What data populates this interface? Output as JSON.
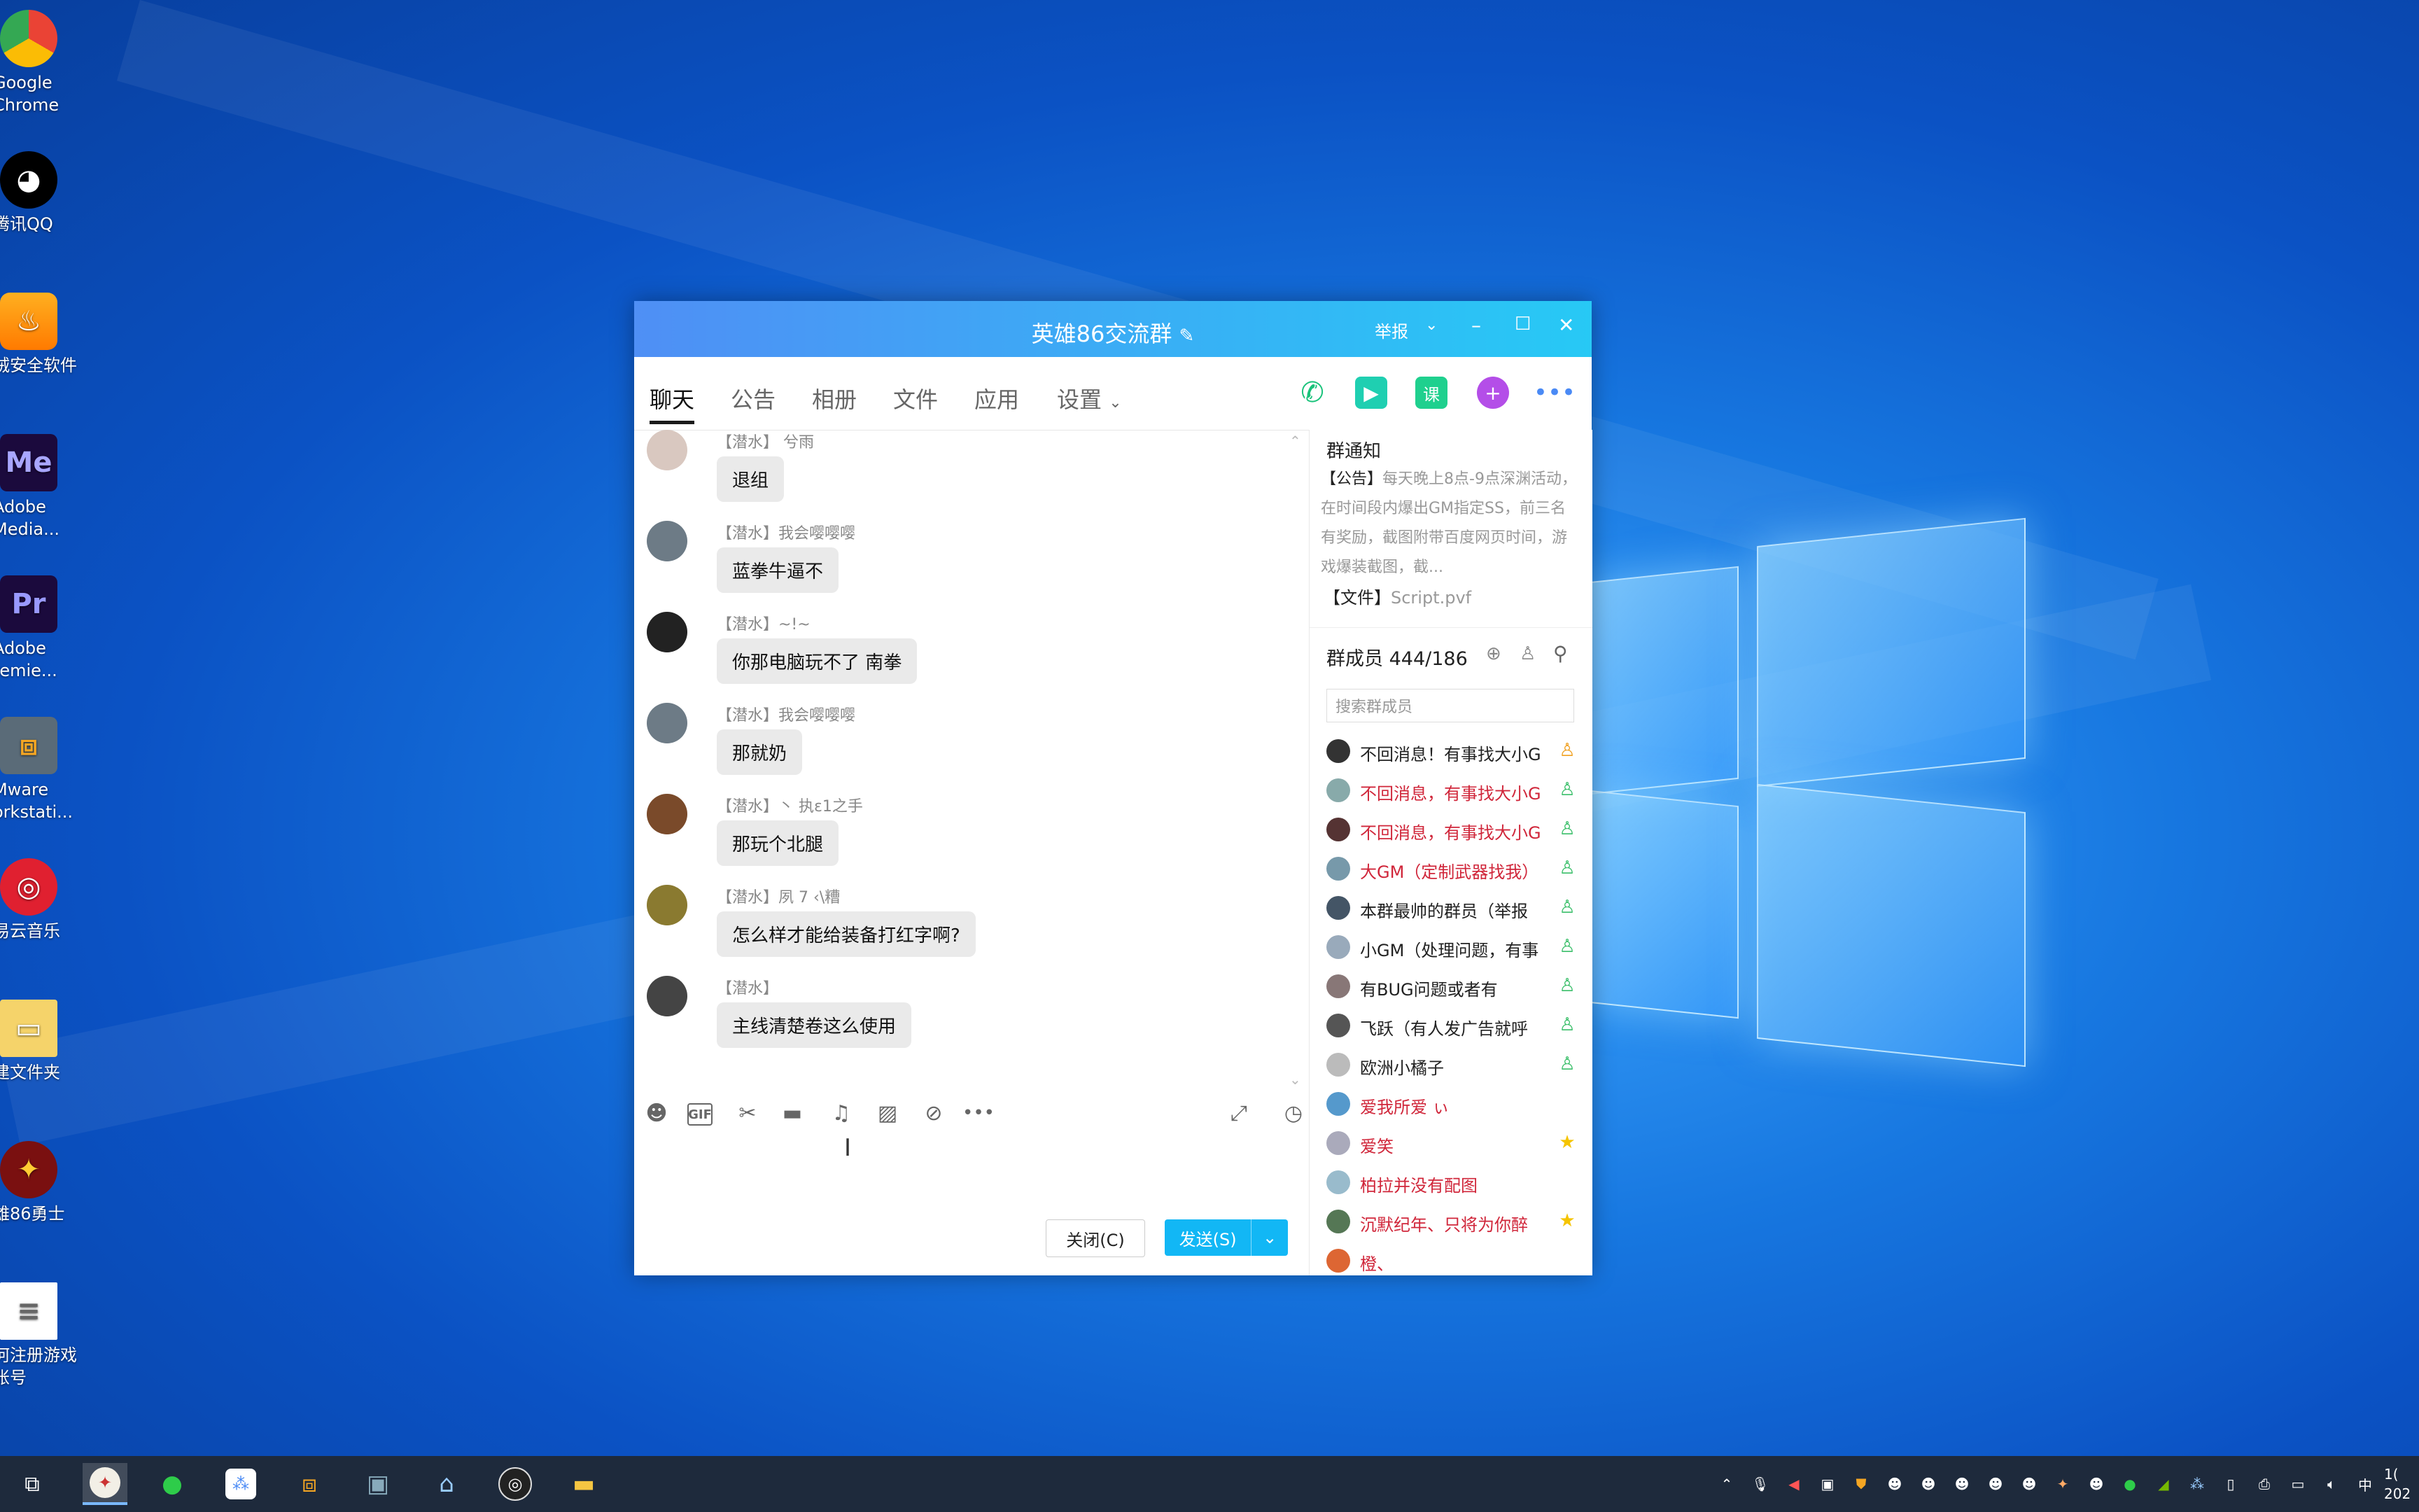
{
  "desktop": {
    "icons": [
      {
        "label": "Google\nChrome",
        "icon": "chrome-icon"
      },
      {
        "label": "腾讯QQ",
        "icon": "qq-icon"
      },
      {
        "label": "绒安全软件",
        "icon": "security-icon"
      },
      {
        "label": "Adobe\nMedia...",
        "icon": "adobe-media-encoder-icon",
        "glyph": "Me"
      },
      {
        "label": "Adobe\nremie...",
        "icon": "adobe-premiere-icon",
        "glyph": "Pr"
      },
      {
        "label": "Mware\norkstati...",
        "icon": "vmware-icon"
      },
      {
        "label": "易云音乐",
        "icon": "netease-music-icon"
      },
      {
        "label": "建文件夹",
        "icon": "folder-icon"
      },
      {
        "label": "雄86勇士",
        "icon": "game-icon"
      },
      {
        "label": "何注册游戏\n账号",
        "icon": "text-file-icon"
      }
    ]
  },
  "window": {
    "title": "英雄86交流群",
    "report": "举报",
    "tabs": [
      "聊天",
      "公告",
      "相册",
      "文件",
      "应用",
      "设置"
    ],
    "active_tab": "聊天"
  },
  "messages": [
    {
      "sender": "【潜水】  兮雨",
      "text": "退组"
    },
    {
      "sender": "【潜水】我会嘤嘤嘤",
      "text": "蓝拳牛逼不"
    },
    {
      "sender": "【潜水】~!~",
      "text": "你那电脑玩不了 南拳"
    },
    {
      "sender": "【潜水】我会嘤嘤嘤",
      "text": "那就奶"
    },
    {
      "sender": "【潜水】丶 执ɛ1之手",
      "text": "那玩个北腿"
    },
    {
      "sender": "【潜水】夙 7 ‹\\糟",
      "text": "怎么样才能给装备打红字啊?"
    },
    {
      "sender": "【潜水】",
      "text": "主线清楚卷这么使用"
    }
  ],
  "composer": {
    "close_label": "关闭(C)",
    "send_label": "发送(S)"
  },
  "sidebar": {
    "notice_title": "群通知",
    "notice_tag": "【公告】",
    "notice_text": "每天晚上8点-9点深渊活动，在时间段内爆出GM指定SS，前三名有奖励，截图附带百度网页时间，游戏爆装截图，截...",
    "file_tag": "【文件】",
    "file_name": "Script.pvf",
    "members_title": "群成员 444/186",
    "member_search_placeholder": "搜索群成员",
    "members": [
      {
        "name": "不回消息！有事找大小G",
        "color": "#222222",
        "badge": "owner-icon"
      },
      {
        "name": "不回消息，有事找大小G",
        "color": "#d0263a",
        "badge": "admin-icon"
      },
      {
        "name": "不回消息，有事找大小G",
        "color": "#d0263a",
        "badge": "admin-icon"
      },
      {
        "name": "大GM（定制武器找我）",
        "color": "#d0263a",
        "badge": "admin-icon"
      },
      {
        "name": "本群最帅的群员（举报",
        "color": "#222222",
        "badge": "admin-icon"
      },
      {
        "name": "小GM（处理问题，有事",
        "color": "#222222",
        "badge": "admin-icon"
      },
      {
        "name": "有BUG问题或者有",
        "color": "#222222",
        "badge": "admin-icon"
      },
      {
        "name": "飞跃（有人发广告就呼",
        "color": "#222222",
        "badge": "admin-icon"
      },
      {
        "name": "欧洲小橘子",
        "color": "#222222",
        "badge": "admin-icon"
      },
      {
        "name": "爱我所爱  ぃ",
        "color": "#d0263a",
        "badge": ""
      },
      {
        "name": "爱笑",
        "color": "#d0263a",
        "badge": "star-icon"
      },
      {
        "name": "柏拉并没有配图",
        "color": "#d0263a",
        "badge": ""
      },
      {
        "name": "沉默纪年、只将为你醉",
        "color": "#d0263a",
        "badge": "star-icon"
      },
      {
        "name": "橙、",
        "color": "#d0263a",
        "badge": ""
      }
    ]
  },
  "taskbar": {
    "ime": "中",
    "clock_time": "1(",
    "clock_date": "202"
  }
}
